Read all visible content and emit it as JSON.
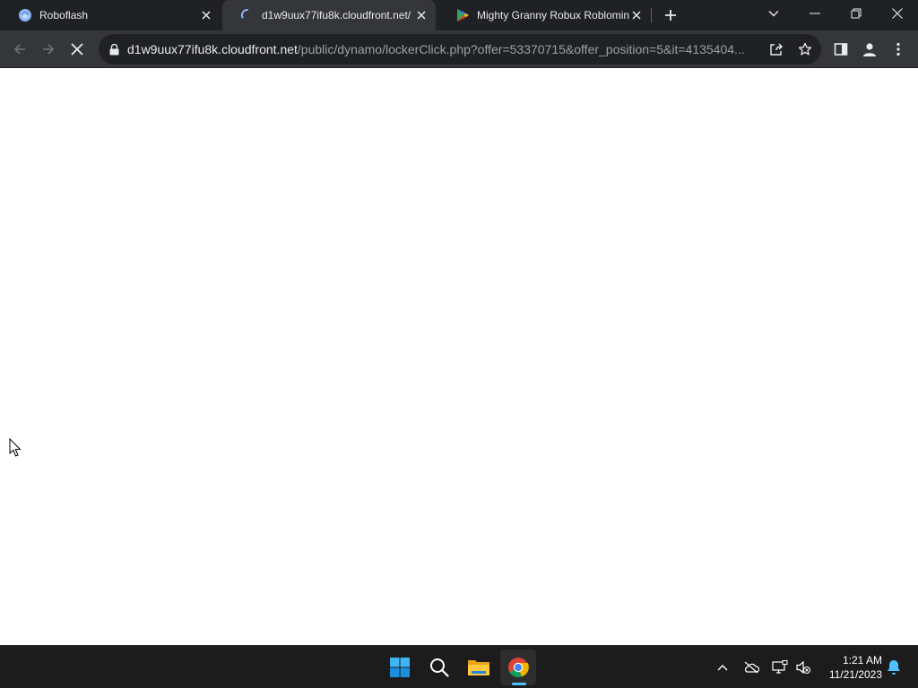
{
  "browser": {
    "tabs": [
      {
        "title": "Roboflash",
        "active": false,
        "icon": "roboflash-favicon"
      },
      {
        "title": "d1w9uux77ifu8k.cloudfront.net/",
        "active": true,
        "icon": "loading-spinner-icon"
      },
      {
        "title": "Mighty Granny Robux Roblomin",
        "active": false,
        "icon": "google-play-icon"
      }
    ],
    "new_tab_icon": "plus-icon",
    "window_controls": [
      "tab-search-icon",
      "minimize-icon",
      "restore-icon",
      "close-icon"
    ]
  },
  "toolbar": {
    "url_host": "d1w9uux77ifu8k.cloudfront.net",
    "url_path": "/public/dynamo/lockerClick.php?offer=53370715&offer_position=5&it=4135404...",
    "loading": true
  },
  "taskbar": {
    "apps": [
      "start-icon",
      "search-icon",
      "file-explorer-icon",
      "chrome-icon"
    ],
    "active_app": "chrome-icon",
    "tray": [
      "chevron-up-icon",
      "onedrive-icon",
      "network-icon",
      "volume-muted-icon",
      "notification-bell-icon"
    ],
    "time": "1:21 AM",
    "date": "11/21/2023"
  },
  "colors": {
    "tabstrip": "#202124",
    "active_tab": "#35363a",
    "omnibox": "#202124",
    "taskbar": "#1c1c1c",
    "accent": "#4cc2ff"
  }
}
